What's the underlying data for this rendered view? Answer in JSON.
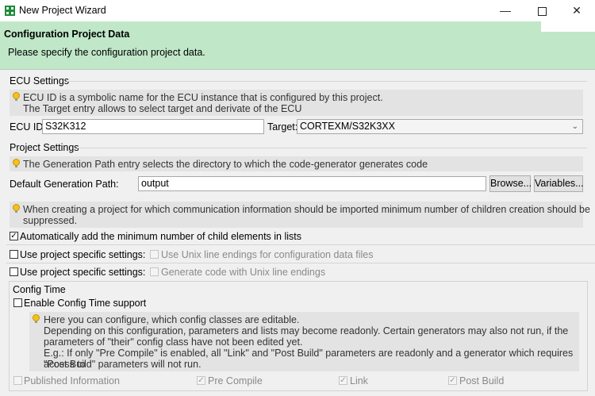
{
  "window": {
    "title": "New Project Wizard"
  },
  "banner": {
    "title": "Configuration Project Data",
    "subtitle": "Please specify the configuration project data."
  },
  "ecu": {
    "group_title": "ECU Settings",
    "hint_line1": "ECU ID is a symbolic name for the ECU instance that is configured by this project.",
    "hint_line2": "The Target entry allows to select target and derivate of the ECU",
    "ecu_id_label": "ECU ID:",
    "ecu_id_value": "S32K312",
    "target_label": "Target:",
    "target_value": "CORTEXM/S32K3XX"
  },
  "project": {
    "group_title": "Project Settings",
    "gen_hint": "The Generation Path entry selects the directory to which the code-generator generates code",
    "gen_path_label": "Default Generation Path:",
    "gen_path_value": "output",
    "browse_label": "Browse...",
    "variables_label": "Variables...",
    "children_hint_line1": "When creating a project for which communication information should be imported minimum number of children creation should be",
    "children_hint_line2": "suppressed.",
    "auto_add_label": "Automatically add the minimum number of child elements in lists",
    "specific1_label": "Use project specific settings:",
    "unix_data_label": "Use Unix line endings for configuration data files",
    "specific2_label": "Use project specific settings:",
    "unix_code_label": "Generate code with Unix line endings"
  },
  "config_time": {
    "group_title": "Config Time",
    "enable_label": "Enable Config Time support",
    "hint_lines": [
      "Here you can configure, which config classes are editable.",
      "Depending on this configuration, parameters and lists may become readonly. Certain generators may also not run, if the",
      "parameters of \"their\" config class have not been edited yet.",
      "E.g.: If only \"Pre Compile\" is enabled, all \"Link\" and \"Post Build\" parameters are readonly and a generator which requires access to",
      "\"Post Build\" parameters will not run."
    ],
    "published_label": "Published Information",
    "pre_compile_label": "Pre Compile",
    "link_label": "Link",
    "post_build_label": "Post Build"
  }
}
